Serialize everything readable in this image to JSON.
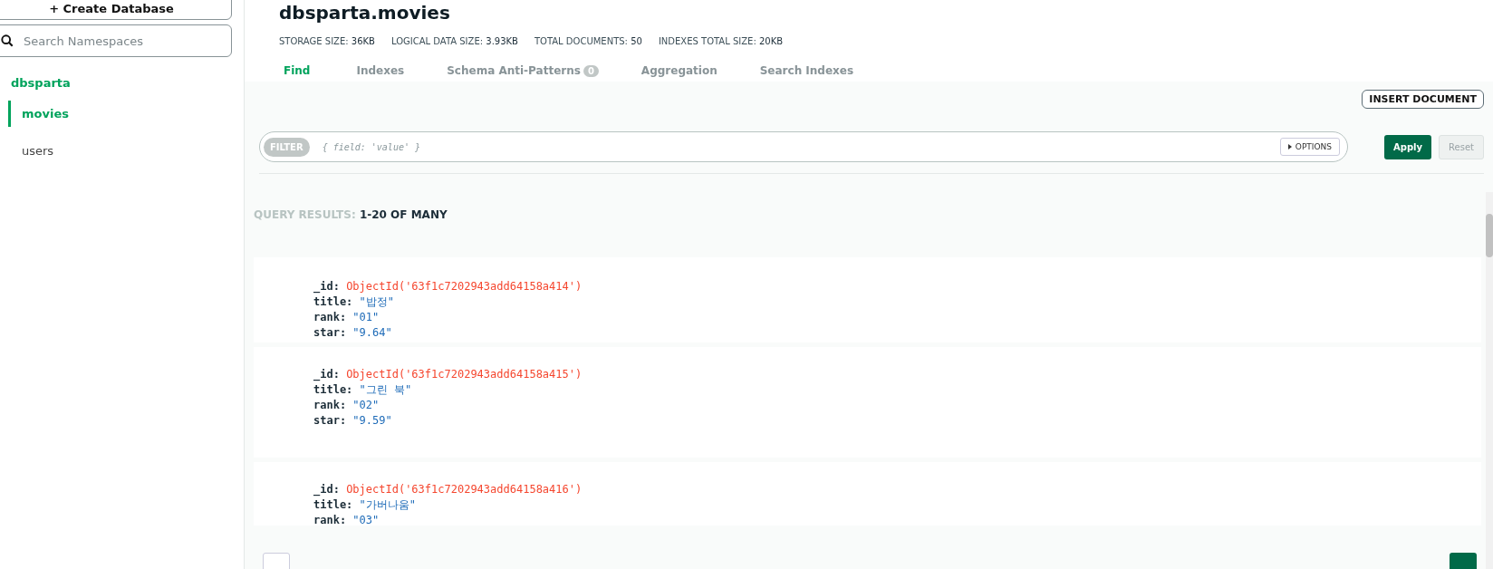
{
  "sidebar": {
    "create_button": {
      "label": "+ Create Database"
    },
    "search": {
      "placeholder": "Search Namespaces"
    },
    "databases": [
      {
        "name": "dbsparta",
        "selected": true,
        "collections": [
          {
            "name": "movies",
            "selected": true
          },
          {
            "name": "users",
            "selected": false
          }
        ]
      }
    ]
  },
  "header": {
    "title": "dbsparta.movies",
    "stats": [
      {
        "label": "STORAGE SIZE:",
        "value": "36KB"
      },
      {
        "label": "LOGICAL DATA SIZE:",
        "value": "3.93KB"
      },
      {
        "label": "TOTAL DOCUMENTS:",
        "value": "50"
      },
      {
        "label": "INDEXES TOTAL SIZE:",
        "value": "20KB"
      }
    ]
  },
  "tabs": [
    {
      "label": "Find",
      "selected": true
    },
    {
      "label": "Indexes",
      "selected": false
    },
    {
      "label": "Schema Anti-Patterns",
      "badge": "0",
      "selected": false
    },
    {
      "label": "Aggregation",
      "selected": false
    },
    {
      "label": "Search Indexes",
      "selected": false
    }
  ],
  "toolbar": {
    "insert_button": "INSERT DOCUMENT"
  },
  "filter": {
    "label": "FILTER",
    "placeholder": "{ field: 'value' }",
    "options_button": "OPTIONS",
    "apply_button": "Apply",
    "reset_button": "Reset",
    "reset_disabled": true
  },
  "results": {
    "label": "QUERY RESULTS:",
    "range": "1-20 OF MANY"
  },
  "documents": [
    {
      "fields": [
        {
          "key": "_id:",
          "value": "ObjectId('63f1c7202943add64158a414')",
          "kind": "objectid"
        },
        {
          "key": "title:",
          "value": "\"밥정\"",
          "kind": "string"
        },
        {
          "key": "rank:",
          "value": "\"01\"",
          "kind": "string"
        },
        {
          "key": "star:",
          "value": "\"9.64\"",
          "kind": "string"
        }
      ]
    },
    {
      "fields": [
        {
          "key": "_id:",
          "value": "ObjectId('63f1c7202943add64158a415')",
          "kind": "objectid"
        },
        {
          "key": "title:",
          "value": "\"그린 북\"",
          "kind": "string"
        },
        {
          "key": "rank:",
          "value": "\"02\"",
          "kind": "string"
        },
        {
          "key": "star:",
          "value": "\"9.59\"",
          "kind": "string"
        }
      ]
    },
    {
      "fields": [
        {
          "key": "_id:",
          "value": "ObjectId('63f1c7202943add64158a416')",
          "kind": "objectid"
        },
        {
          "key": "title:",
          "value": "\"가버나움\"",
          "kind": "string"
        },
        {
          "key": "rank:",
          "value": "\"03\"",
          "kind": "string"
        }
      ]
    }
  ]
}
